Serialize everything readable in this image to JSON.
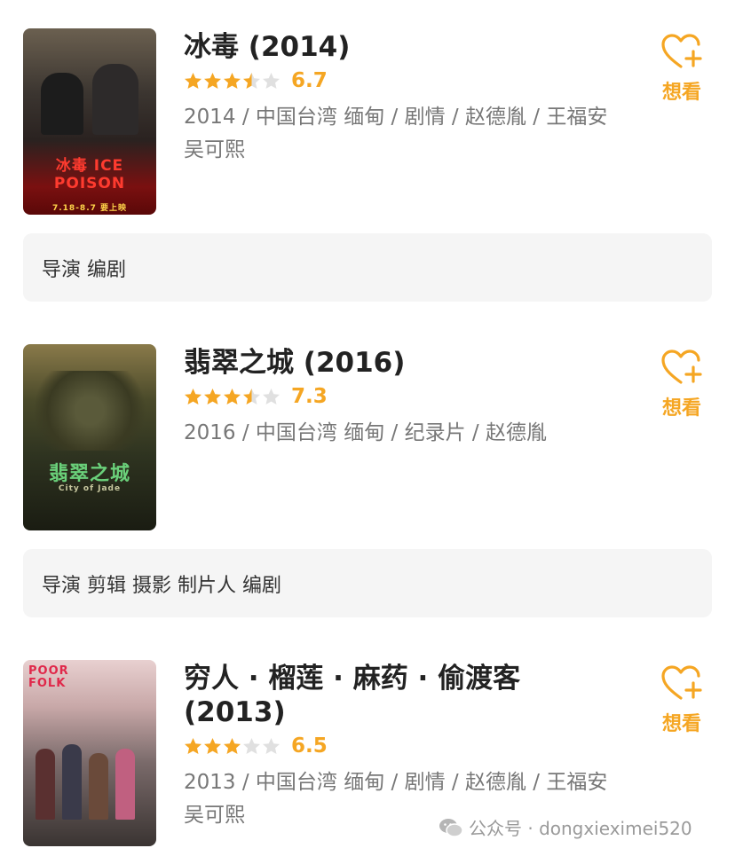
{
  "movies": [
    {
      "title": "冰毒 (2014)",
      "rating": 6.7,
      "rating_text": "6.7",
      "stars": 3.5,
      "meta": "2014 / 中国台湾 缅甸 / 剧情 / 赵德胤 / 王福安 吴可熙",
      "want_label": "想看",
      "roles": "导演 编剧",
      "poster": {
        "title_text": "冰毒 ICE POISON",
        "date_text": "7.18-8.7 要上映"
      }
    },
    {
      "title": "翡翠之城 (2016)",
      "rating": 7.3,
      "rating_text": "7.3",
      "stars": 3.5,
      "meta": "2016 / 中国台湾 缅甸 / 纪录片 / 赵德胤",
      "want_label": "想看",
      "roles": "导演 剪辑 摄影 制片人 编剧",
      "poster": {
        "title_text": "翡翠之城",
        "sub_text": "City of Jade"
      }
    },
    {
      "title": "穷人 · 榴莲 · 麻药 · 偷渡客 (2013)",
      "rating": 6.5,
      "rating_text": "6.5",
      "stars": 3,
      "meta": "2013 / 中国台湾 缅甸 / 剧情 / 赵德胤 / 王福安 吴可熙",
      "want_label": "想看",
      "roles": "",
      "poster": {
        "title_text": "POOR FOLK"
      }
    }
  ],
  "footer": {
    "icon": "wechat-icon",
    "text": "公众号 · dongxieximei520"
  },
  "colors": {
    "accent": "#f5a623",
    "star_empty": "#e0e0e0",
    "roles_bg": "#f5f5f5"
  }
}
